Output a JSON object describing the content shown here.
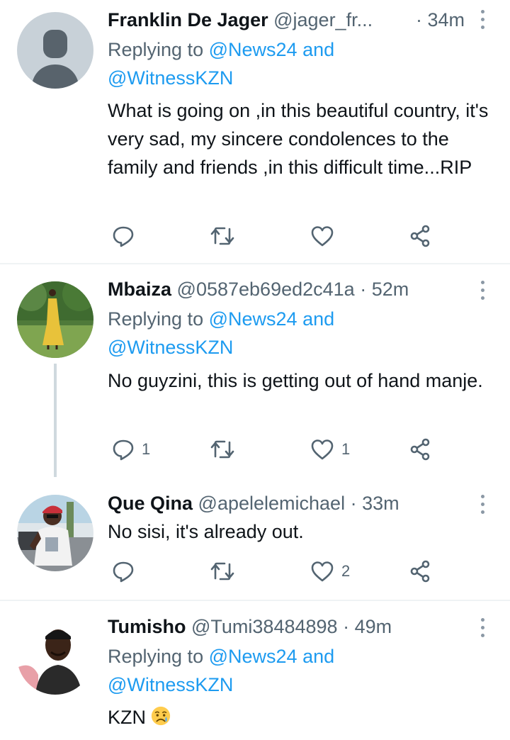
{
  "tweets": [
    {
      "name": "Franklin De Jager",
      "handle": "@jager_fr...",
      "time": "· 34m",
      "replying_prefix": "Replying to ",
      "replying_1": "@News24",
      "replying_and": " and",
      "replying_2": "@WitnessKZN",
      "text": "What is going on ,in this beautiful country, it's very sad, my sincere condolences to the family and friends ,in this difficult time...RIP",
      "reply_count": "",
      "like_count": ""
    },
    {
      "name": "Mbaiza",
      "handle": "@0587eb69ed2c41a",
      "time": "· 52m",
      "replying_prefix": "Replying to ",
      "replying_1": "@News24",
      "replying_and": " and",
      "replying_2": "@WitnessKZN",
      "text": "No guyzini, this is getting out of hand manje.",
      "reply_count": "1",
      "like_count": "1"
    },
    {
      "name": "Que Qina",
      "handle": "@apelelemichael",
      "time": "· 33m",
      "text": "No sisi, it's already out.",
      "reply_count": "",
      "like_count": "2"
    },
    {
      "name": "Tumisho",
      "handle": "@Tumi38484898",
      "time": "· 49m",
      "replying_prefix": "Replying to ",
      "replying_1": "@News24",
      "replying_and": " and",
      "replying_2": "@WitnessKZN",
      "text": "KZN",
      "emoji": "sad-but-relieved-face"
    }
  ],
  "colors": {
    "text": "#0f1419",
    "secondary": "#536471",
    "link": "#1d9bf0",
    "divider": "#eff3f4",
    "thread_line": "#cfd9de"
  },
  "icons": [
    "reply-icon",
    "retweet-icon",
    "like-icon",
    "share-icon",
    "more-icon"
  ]
}
